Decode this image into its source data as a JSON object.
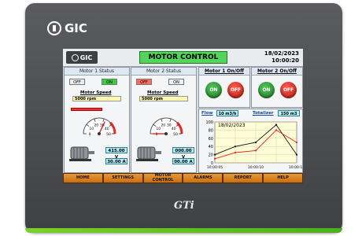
{
  "device": {
    "brand": "GIC",
    "model": "GTi"
  },
  "screen": {
    "logo_text": "GIC",
    "title": "MOTOR CONTROL",
    "date": "18/02/2023",
    "time": "10:00:20"
  },
  "motor1": {
    "header": "Motor 1 Status",
    "off_label": "OFF",
    "on_label": "ON",
    "active": "ON",
    "speed_label": "Motor Speed",
    "speed_value": "5000 rpm",
    "voltage": "415.00 V",
    "current": "30.00 A",
    "gauge_ticks": [
      "0",
      "10",
      "20",
      "30",
      "40",
      "50"
    ],
    "gauge_value": 32
  },
  "motor2": {
    "header": "Motor 2 Status",
    "off_label": "OFF",
    "on_label": "ON",
    "active": "OFF",
    "speed_label": "Motor Speed",
    "speed_value": "5000 rpm",
    "voltage": "000.00 V",
    "current": "00.00 A",
    "gauge_ticks": [
      "0",
      "10",
      "20",
      "30",
      "40",
      "50"
    ],
    "gauge_value": 0
  },
  "switch1": {
    "header": "Motor 1 On/Off",
    "on": "ON",
    "off": "OFF"
  },
  "switch2": {
    "header": "Motor 2 On/Off",
    "on": "ON",
    "off": "OFF"
  },
  "flow": {
    "label": "Flow",
    "value": "10 m3/h",
    "totalizer_label": "Totalizer",
    "totalizer_value": "150 m3"
  },
  "chart_data": {
    "type": "line",
    "title": "18/02/2023",
    "x": [
      "10:00:05",
      "10:00:10",
      "10:00:15"
    ],
    "ylim": [
      0,
      100
    ],
    "yticks": [
      "100",
      "80",
      "60",
      "40",
      "20",
      "0"
    ],
    "series": [
      {
        "color": "#111111",
        "values": [
          [
            0,
            20
          ],
          [
            1,
            40
          ],
          [
            2,
            50
          ],
          [
            3,
            93
          ],
          [
            4,
            20
          ]
        ]
      },
      {
        "color": "#e82020",
        "values": [
          [
            0,
            10
          ],
          [
            1,
            25
          ],
          [
            2,
            30
          ],
          [
            3,
            80
          ],
          [
            4,
            50
          ]
        ]
      }
    ],
    "grid": true,
    "background": "#fffdd6"
  },
  "nav": [
    "HOME",
    "SETTINGS",
    "MOTOR\nCONTROL",
    "ALARMS",
    "REPORT",
    "HELP"
  ]
}
